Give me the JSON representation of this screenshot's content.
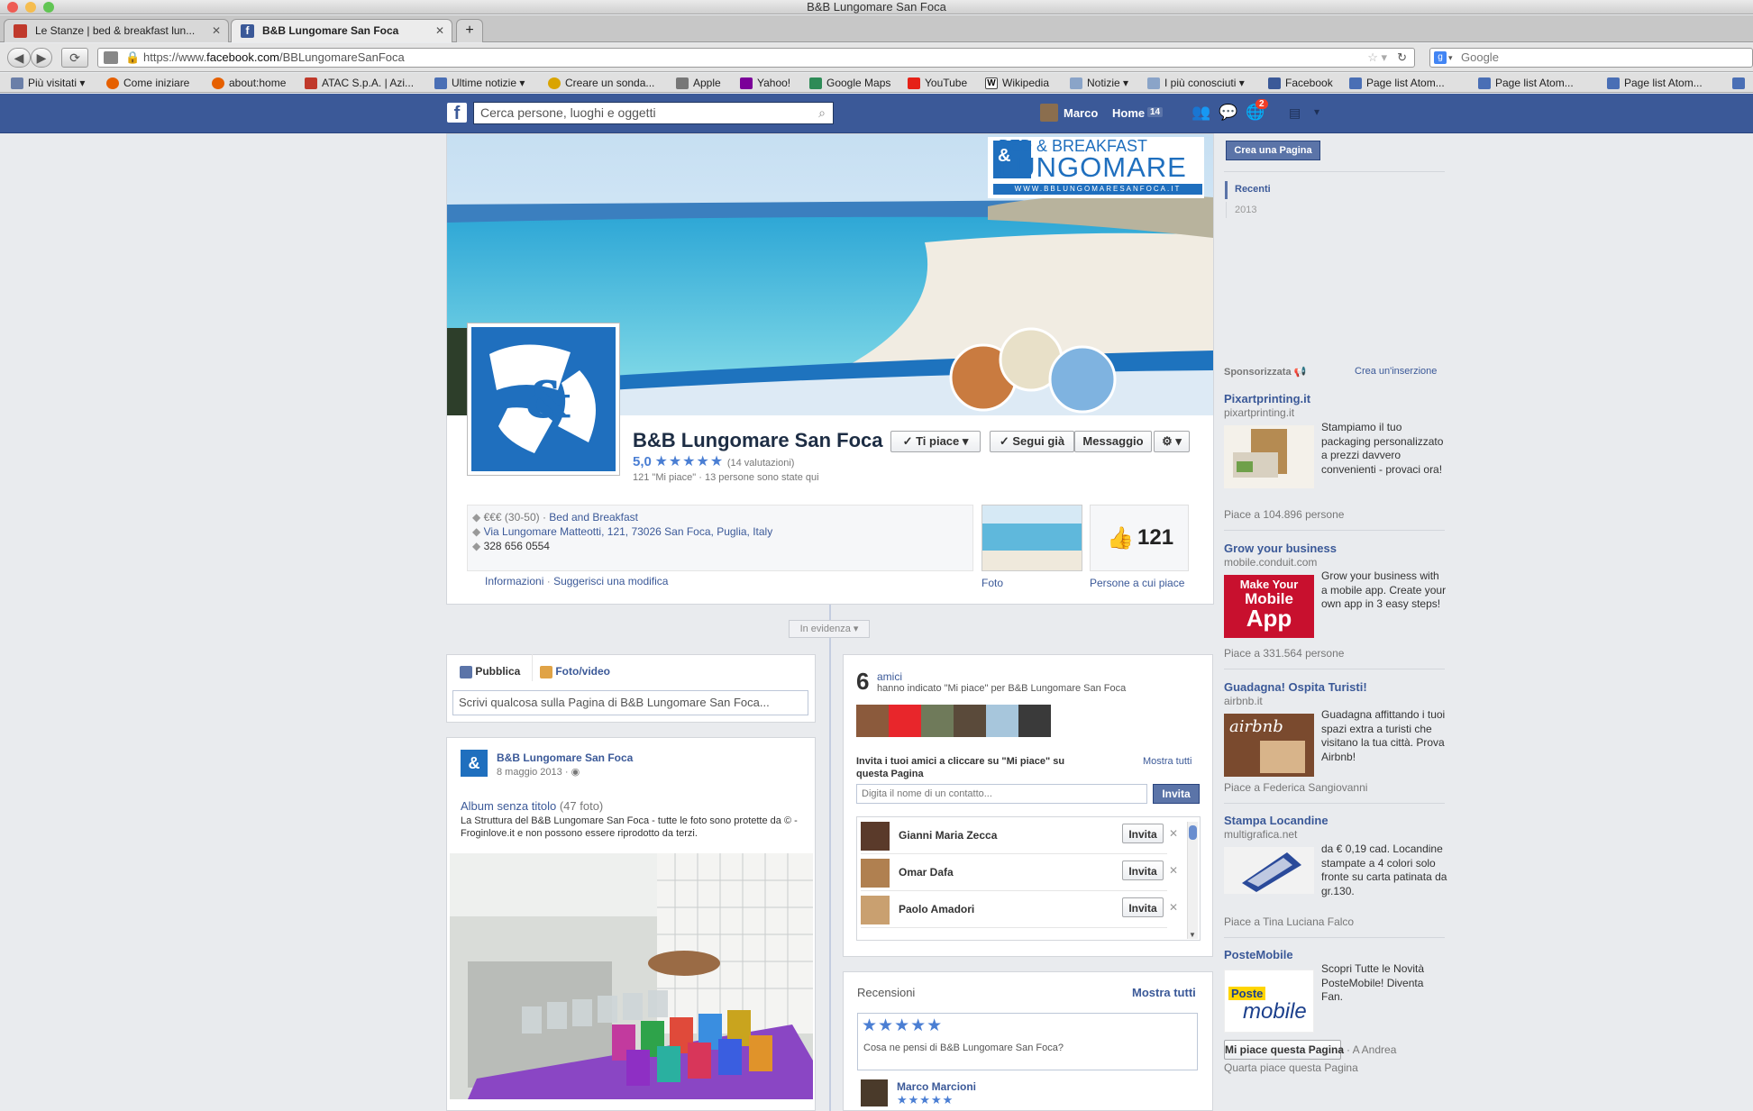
{
  "window": {
    "title": "B&B Lungomare San Foca"
  },
  "tabs": [
    {
      "label": "Le Stanze | bed & breakfast lun...",
      "active": false
    },
    {
      "label": "B&B Lungomare San Foca",
      "active": true
    }
  ],
  "url": {
    "prefix": "https://www.",
    "domain": "facebook.com",
    "path": "/BBLungomareSanFoca"
  },
  "browser_search": {
    "placeholder": "Google"
  },
  "bookmarks": [
    {
      "label": "Più visitati ▾",
      "icon": "grid-icon",
      "color": "#6b7fa8"
    },
    {
      "label": "Come iniziare",
      "icon": "firefox-icon",
      "color": "#e66000"
    },
    {
      "label": "about:home",
      "icon": "firefox-icon",
      "color": "#e66000"
    },
    {
      "label": "ATAC S.p.A. | Azi...",
      "icon": "atac-icon",
      "color": "#c0392b"
    },
    {
      "label": "Ultime notizie ▾",
      "icon": "rss-icon",
      "color": "#4a6fb5"
    },
    {
      "label": "Creare un sonda...",
      "icon": "clock-icon",
      "color": "#d9a400"
    },
    {
      "label": "Apple",
      "icon": "apple-icon",
      "color": "#777777"
    },
    {
      "label": "Yahoo!",
      "icon": "yahoo-icon",
      "color": "#7b0099"
    },
    {
      "label": "Google Maps",
      "icon": "maps-icon",
      "color": "#2e8b57"
    },
    {
      "label": "YouTube",
      "icon": "youtube-icon",
      "color": "#e62117"
    },
    {
      "label": "Wikipedia",
      "icon": "wikipedia-icon",
      "color": "#222222"
    },
    {
      "label": "Notizie ▾",
      "icon": "folder-icon",
      "color": "#8aa4c8"
    },
    {
      "label": "I più conosciuti ▾",
      "icon": "folder-icon",
      "color": "#8aa4c8"
    },
    {
      "label": "Facebook",
      "icon": "facebook-icon",
      "color": "#3b5998"
    },
    {
      "label": "Page list Atom...",
      "icon": "rss-icon",
      "color": "#4a6fb5"
    },
    {
      "label": "Page list Atom...",
      "icon": "rss-icon",
      "color": "#4a6fb5"
    },
    {
      "label": "Page list Atom...",
      "icon": "rss-icon",
      "color": "#4a6fb5"
    }
  ],
  "fb": {
    "search_placeholder": "Cerca persone, luoghi e oggetti",
    "user": "Marco",
    "home": "Home",
    "home_count": "14",
    "notif_count": "2"
  },
  "page": {
    "name": "B&B Lungomare San Foca",
    "cover_logo_top": "BED & BREAKFAST",
    "cover_logo_main": "LUNGOMARE",
    "cover_logo_url": "WWW.BBLUNGOMARESANFOCA.IT",
    "rating": "5,0",
    "stars": "★★★★★",
    "ratings_count": "(14 valutazioni)",
    "likes_line": "121 \"Mi piace\" · 13 persone sono state qui",
    "btn_like": "✓ Ti piace ▾",
    "btn_follow": "✓ Segui già",
    "btn_message": "Messaggio",
    "btn_settings": "⚙ ▾",
    "price": "€€€ (30-50) · ",
    "category": "Bed and Breakfast",
    "address": "Via Lungomare Matteotti, 121, 73026 San Foca, Puglia, Italy",
    "phone": "328 656 0554",
    "link_info": "Informazioni",
    "link_suggest": "Suggerisci una modifica",
    "photos_label": "Foto",
    "likes_count": "121",
    "likers_label": "Persone a cui piace",
    "highlights": "In evidenza ▾"
  },
  "composer": {
    "tab_publish": "Pubblica",
    "tab_photo": "Foto/video",
    "placeholder": "Scrivi qualcosa sulla Pagina di B&B Lungomare San Foca..."
  },
  "post": {
    "author": "B&B Lungomare San Foca",
    "date": "8 maggio 2013 · ",
    "album_title": "Album senza titolo",
    "album_count": " (47 foto)",
    "text": "La Struttura del B&B Lungomare San Foca - tutte le foto sono protette da © - Froginlove.it e non possono essere riprodotto da terzi."
  },
  "friends_box": {
    "count": "6",
    "label": "amici",
    "sub": "hanno indicato \"Mi piace\" per B&B Lungomare San Foca",
    "invite_title": "Invita i tuoi amici a cliccare su \"Mi piace\" su questa Pagina",
    "show_all": "Mostra tutti",
    "input_placeholder": "Digita il nome di un contatto...",
    "invite_btn": "Invita",
    "friends": [
      {
        "name": "Gianni Maria Zecca",
        "btn": "Invita"
      },
      {
        "name": "Omar Dafa",
        "btn": "Invita"
      },
      {
        "name": "Paolo Amadori",
        "btn": "Invita"
      }
    ]
  },
  "reviews": {
    "title": "Recensioni",
    "show_all": "Mostra tutti",
    "stars": "★★★★★",
    "prompt": "Cosa ne pensi di B&B Lungomare San Foca?",
    "reviewer": "Marco Marcioni",
    "reviewer_stars": "★★★★★"
  },
  "sidebar": {
    "create_page": "Crea una Pagina",
    "timeline_recent": "Recenti",
    "timeline_year": "2013",
    "sponsored": "Sponsorizzata",
    "create_ad": "Crea un'inserzione"
  },
  "ads": [
    {
      "title": "Pixartprinting.it",
      "domain": "pixartprinting.it",
      "text": "Stampiamo il tuo packaging personalizzato a prezzi davvero convenienti - provaci ora!",
      "social": "Piace a 104.896 persone"
    },
    {
      "title": "Grow your business",
      "domain": "mobile.conduit.com",
      "text": "Grow your business with a mobile app. Create your own app in 3 easy steps!",
      "social": "Piace a 331.564 persone",
      "img_text_1": "Make Your",
      "img_text_2": "Mobile",
      "img_text_3": "App"
    },
    {
      "title": "Guadagna! Ospita Turisti!",
      "domain": "airbnb.it",
      "text": "Guadagna affittando i tuoi spazi extra a turisti che visitano la tua città. Prova Airbnb!",
      "social": "Piace a Federica Sangiovanni",
      "img_text_1": "airbnb"
    },
    {
      "title": "Stampa Locandine",
      "domain": "multigrafica.net",
      "text": "da € 0,19 cad. Locandine stampate a 4 colori solo fronte su carta patinata da gr.130.",
      "social": "Piace a Tina Luciana Falco"
    },
    {
      "title": "PosteMobile",
      "domain": "",
      "text": "Scopri Tutte le Novità PosteMobile! Diventa Fan.",
      "social": "Quarta piace questa Pagina",
      "like_btn": "Mi piace questa Pagina",
      "like_suffix": "· A Andrea",
      "img_text_1": "Poste",
      "img_text_2": "mobile"
    }
  ]
}
